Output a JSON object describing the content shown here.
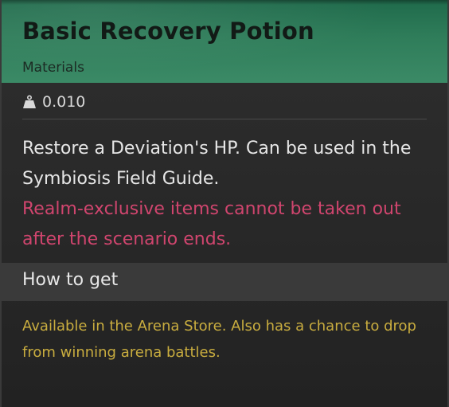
{
  "item": {
    "title": "Basic Recovery Potion",
    "category": "Materials",
    "weight": "0.010",
    "weight_icon": "weight-icon",
    "description": "Restore a Deviation's HP. Can be used in the Symbiosis Field Guide.",
    "warning": "Realm-exclusive items cannot be taken out after the scenario ends."
  },
  "how_to_get": {
    "label": "How to get",
    "text": "Available in the Arena Store. Also has a chance to drop from winning arena battles."
  },
  "colors": {
    "header_green": "#2f7d5a",
    "warning_pink": "#d0456e",
    "source_gold": "#c9ad3f",
    "panel_bg": "#2a2a2a"
  }
}
